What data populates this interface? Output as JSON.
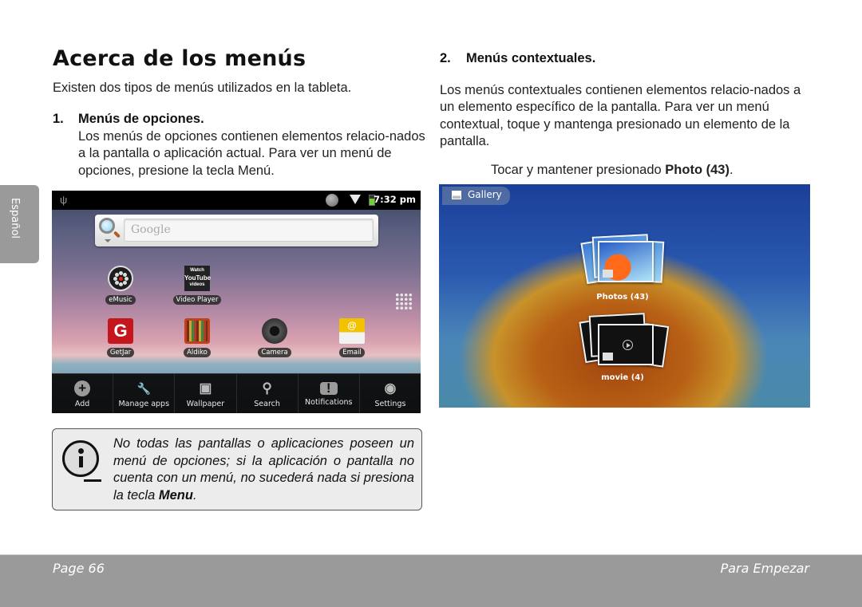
{
  "page": {
    "title": "Acerca de los menús",
    "intro": "Existen dos tipos de menús utilizados en la tableta.",
    "language_tab": "Español"
  },
  "section1": {
    "number": "1.",
    "heading": "Menús de opciones.",
    "body": "Los menús de opciones contienen elementos relacio-nados a la pantalla o aplicación actual. Para ver un menú de opciones, presione la tecla Menú."
  },
  "home_screen": {
    "status_bar": {
      "time": "7:32 pm",
      "icons": [
        "usb-icon",
        "search-sync-icon",
        "wifi-icon",
        "battery-charging-icon"
      ]
    },
    "search_widget": {
      "placeholder": "Google"
    },
    "apps": [
      {
        "label": "eMusic",
        "icon": "emusic-icon"
      },
      {
        "label": "Video Player",
        "icon": "youtube-icon",
        "icon_text": [
          "Watch",
          "YouTube",
          "videos"
        ]
      },
      {
        "label": "GetJar",
        "icon": "getjar-icon",
        "icon_text": "G"
      },
      {
        "label": "Aldiko",
        "icon": "aldiko-icon"
      },
      {
        "label": "Camera",
        "icon": "camera-icon"
      },
      {
        "label": "Email",
        "icon": "email-icon",
        "icon_text": "@"
      }
    ],
    "options_menu": [
      {
        "label": "Add",
        "icon": "add-icon",
        "glyph": "+"
      },
      {
        "label": "Manage apps",
        "icon": "manage-apps-icon",
        "glyph": "🔧"
      },
      {
        "label": "Wallpaper",
        "icon": "wallpaper-icon",
        "glyph": "▣"
      },
      {
        "label": "Search",
        "icon": "search-icon",
        "glyph": "⚲"
      },
      {
        "label": "Notifications",
        "icon": "notifications-icon",
        "glyph": "!"
      },
      {
        "label": "Settings",
        "icon": "settings-icon",
        "glyph": "◉"
      }
    ]
  },
  "note": {
    "text_before": "No todas las pantallas o aplicaciones poseen un menú de opciones; si la aplicación o pantalla no cuenta con un menú, no sucederá nada si presiona la tecla ",
    "bold": "Menu",
    "text_after": "."
  },
  "section2": {
    "number": "2.",
    "heading": "Menús contextuales.",
    "body": "Los menús contextuales contienen elementos relacio-nados a un elemento específico de la pantalla. Para ver un menú contextual, toque y mantenga presionado un elemento de la pantalla.",
    "caption_before": "Tocar y mantener presionado ",
    "caption_bold": "Photo (43)",
    "caption_after": "."
  },
  "gallery": {
    "title": "Gallery",
    "albums": [
      {
        "label": "Photos  (43)"
      },
      {
        "label": "movie  (4)"
      }
    ]
  },
  "footer": {
    "page": "Page 66",
    "section": "Para Empezar"
  }
}
